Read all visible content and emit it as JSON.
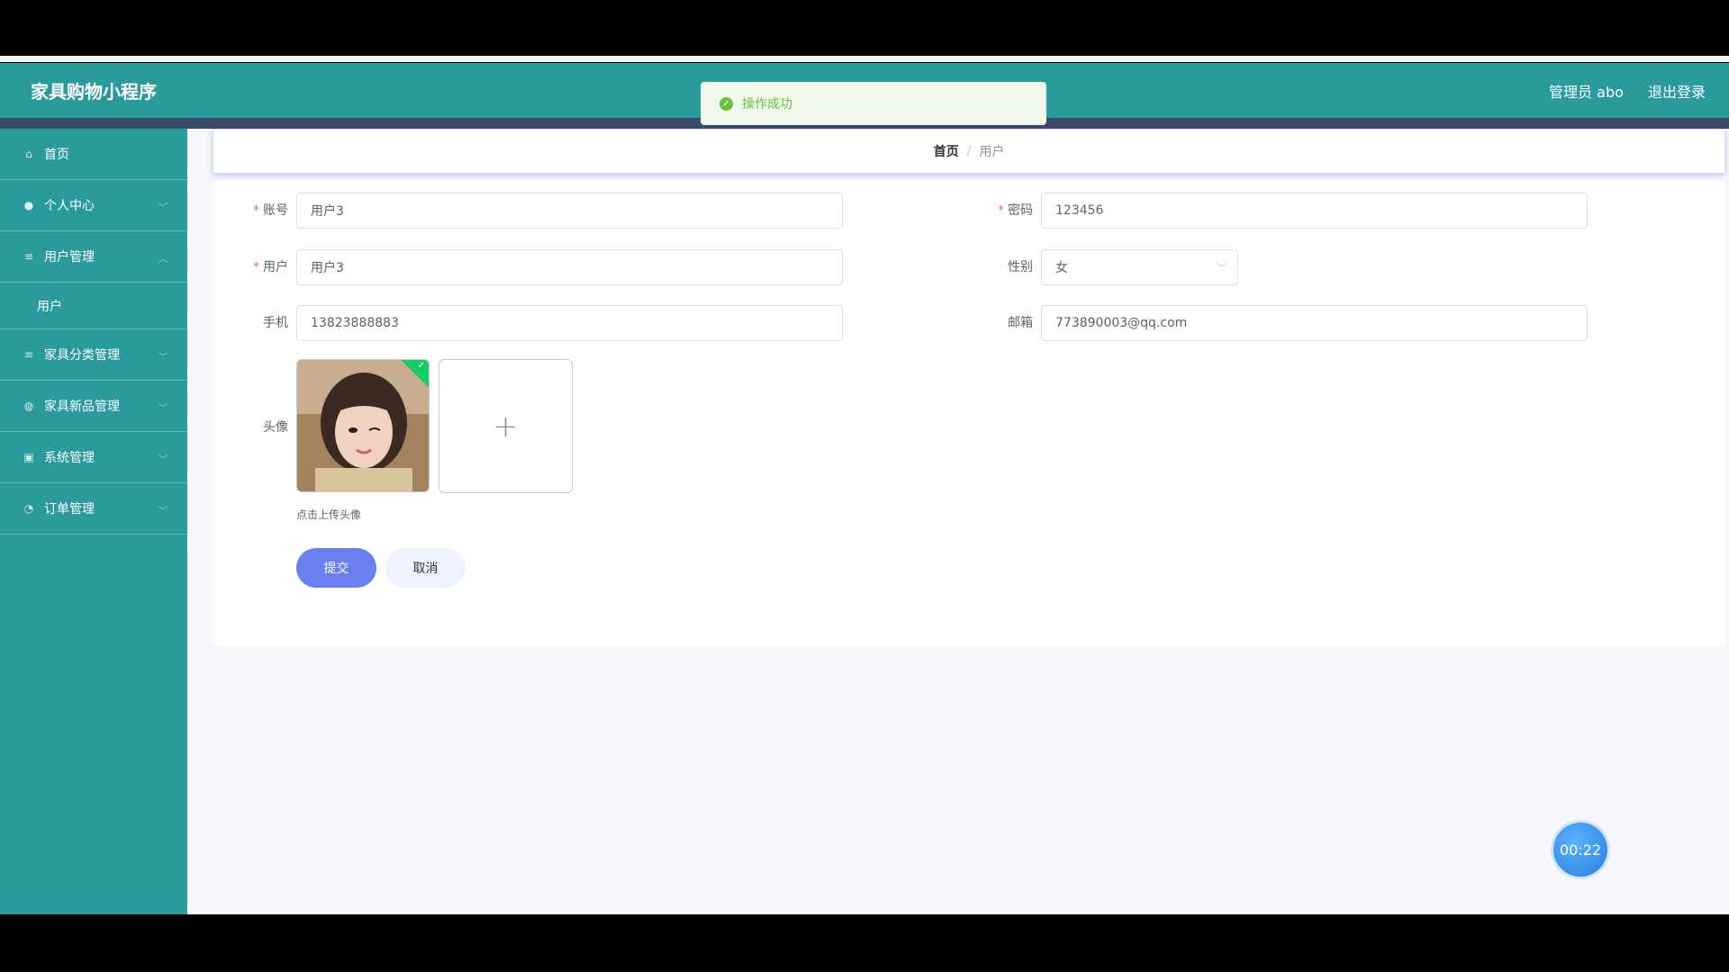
{
  "header": {
    "app_title": "家具购物小程序",
    "admin_label": "管理员 abo",
    "logout_label": "退出登录"
  },
  "toast": {
    "message": "操作成功"
  },
  "sidebar": {
    "items": [
      {
        "label": "首页",
        "icon": "home-icon"
      },
      {
        "label": "个人中心",
        "icon": "user-icon"
      },
      {
        "label": "用户管理",
        "icon": "menu-icon",
        "expanded": true,
        "children": [
          {
            "label": "用户"
          }
        ]
      },
      {
        "label": "家具分类管理",
        "icon": "menu-icon"
      },
      {
        "label": "家具新品管理",
        "icon": "globe-icon"
      },
      {
        "label": "系统管理",
        "icon": "clipboard-icon"
      },
      {
        "label": "订单管理",
        "icon": "gauge-icon"
      }
    ]
  },
  "breadcrumb": {
    "home": "首页",
    "separator": "/",
    "current": "用户"
  },
  "form": {
    "account": {
      "label": "账号",
      "value": "用户3",
      "required": true
    },
    "password": {
      "label": "密码",
      "value": "123456",
      "required": true
    },
    "username": {
      "label": "用户",
      "value": "用户3",
      "required": true
    },
    "gender": {
      "label": "性别",
      "value": "女"
    },
    "phone": {
      "label": "手机",
      "value": "13823888883"
    },
    "email": {
      "label": "邮箱",
      "value": "773890003@qq.com"
    },
    "avatar": {
      "label": "头像",
      "tip": "点击上传头像"
    },
    "submit_label": "提交",
    "cancel_label": "取消"
  },
  "timer": {
    "value": "00:22"
  },
  "colors": {
    "primary": "#2a9a9c",
    "header_strip": "#3b4a66",
    "submit": "#6b7ff0",
    "success": "#67c23a",
    "required": "#f56c6c"
  }
}
